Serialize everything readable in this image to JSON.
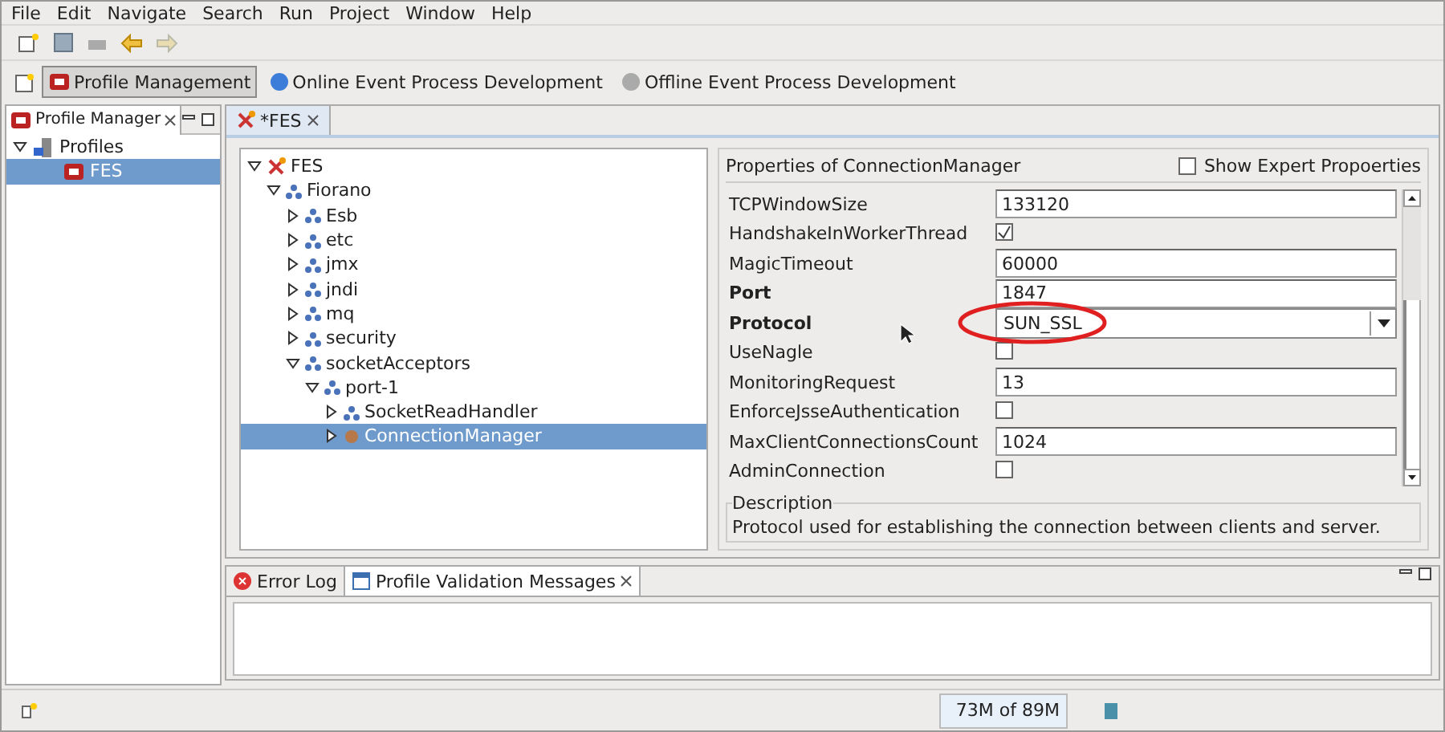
{
  "menu": [
    "File",
    "Edit",
    "Navigate",
    "Search",
    "Run",
    "Project",
    "Window",
    "Help"
  ],
  "perspectives": [
    {
      "label": "Profile Management",
      "selected": true,
      "kind": "profile"
    },
    {
      "label": "Online Event Process Development",
      "selected": false,
      "kind": "online"
    },
    {
      "label": "Offline Event Process Development",
      "selected": false,
      "kind": "offline"
    }
  ],
  "profile_manager": {
    "title": "Profile Manager",
    "tree": [
      {
        "label": "Profiles",
        "kind": "computer",
        "expanded": true,
        "selected": false,
        "children": [
          {
            "label": "FES",
            "kind": "profile",
            "selected": true
          }
        ]
      }
    ]
  },
  "editor": {
    "tab": "*FES",
    "tree": [
      {
        "label": "FES",
        "kind": "tools",
        "expanded": true,
        "selected": false,
        "children": [
          {
            "label": "Fiorano",
            "kind": "node",
            "expanded": true,
            "selected": false,
            "children": [
              {
                "label": "Esb",
                "kind": "node",
                "expanded": false,
                "selected": false
              },
              {
                "label": "etc",
                "kind": "node",
                "expanded": false,
                "selected": false
              },
              {
                "label": "jmx",
                "kind": "node",
                "expanded": false,
                "selected": false
              },
              {
                "label": "jndi",
                "kind": "node",
                "expanded": false,
                "selected": false
              },
              {
                "label": "mq",
                "kind": "node",
                "expanded": false,
                "selected": false
              },
              {
                "label": "security",
                "kind": "node",
                "expanded": false,
                "selected": false
              },
              {
                "label": "socketAcceptors",
                "kind": "node",
                "expanded": true,
                "selected": false,
                "children": [
                  {
                    "label": "port-1",
                    "kind": "node",
                    "expanded": true,
                    "selected": false,
                    "children": [
                      {
                        "label": "SocketReadHandler",
                        "kind": "node",
                        "expanded": false,
                        "selected": false
                      },
                      {
                        "label": "ConnectionManager",
                        "kind": "bean",
                        "expanded": false,
                        "selected": true
                      }
                    ]
                  }
                ]
              }
            ]
          }
        ]
      }
    ],
    "properties": {
      "title": "Properties of ConnectionManager",
      "expert_label": "Show Expert Propoerties",
      "expert_checked": false,
      "rows": [
        {
          "label": "TCPWindowSize",
          "kind": "text",
          "value": "133120",
          "required": false
        },
        {
          "label": "HandshakeInWorkerThread",
          "kind": "checkbox",
          "checked": true,
          "required": false
        },
        {
          "label": "MagicTimeout",
          "kind": "text",
          "value": "60000",
          "required": false
        },
        {
          "label": "Port",
          "kind": "text",
          "value": "1847",
          "required": true
        },
        {
          "label": "Protocol",
          "kind": "dropdown",
          "value": "SUN_SSL",
          "required": true,
          "highlighted": true
        },
        {
          "label": "UseNagle",
          "kind": "checkbox",
          "checked": false,
          "required": false
        },
        {
          "label": "MonitoringRequest",
          "kind": "text",
          "value": "13",
          "required": false
        },
        {
          "label": "EnforceJsseAuthentication",
          "kind": "checkbox",
          "checked": false,
          "required": false
        },
        {
          "label": "MaxClientConnectionsCount",
          "kind": "text",
          "value": "1024",
          "required": false
        },
        {
          "label": "AdminConnection",
          "kind": "checkbox",
          "checked": false,
          "required": false
        }
      ],
      "description_title": "Description",
      "description": "Protocol used for establishing the connection between clients and server."
    }
  },
  "bottom_tabs": [
    {
      "label": "Error Log",
      "selected": false,
      "kind": "error"
    },
    {
      "label": "Profile Validation Messages",
      "selected": true,
      "kind": "messages"
    }
  ],
  "status_bar": {
    "memory": "73M of 89M"
  }
}
